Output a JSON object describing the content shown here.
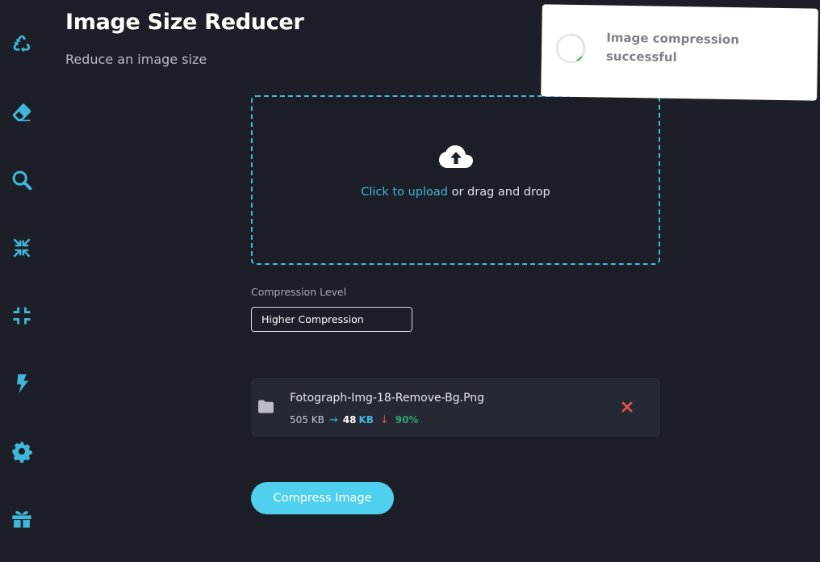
{
  "page": {
    "title": "Image Size Reducer",
    "subtitle": "Reduce an image size"
  },
  "sidebar": {
    "items": [
      {
        "icon": "recycle-icon"
      },
      {
        "icon": "eraser-icon"
      },
      {
        "icon": "search-icon"
      },
      {
        "icon": "compress-arrows-icon"
      },
      {
        "icon": "compress-icon",
        "active": true
      },
      {
        "icon": "bolt-icon"
      },
      {
        "icon": "gear-icon"
      },
      {
        "icon": "gift-icon"
      }
    ]
  },
  "upload": {
    "link_text": "Click to upload",
    "rest_text": " or drag and drop",
    "icon": "cloud-upload-icon"
  },
  "compression": {
    "label": "Compression Level",
    "selected": "Higher Compression"
  },
  "file": {
    "name": "Fotograph-Img-18-Remove-Bg.Png",
    "original_size": "505 KB",
    "new_size": "48",
    "new_unit": "KB",
    "reduction": "90%",
    "icon": "folder-icon"
  },
  "actions": {
    "compress_label": "Compress Image"
  },
  "toast": {
    "message": "Image compression successful"
  },
  "colors": {
    "background": "#1c1f27",
    "accent": "#3fb8d8",
    "button": "#4fd0ee",
    "success": "#2ea66a",
    "danger": "#e35050",
    "card": "#252933"
  }
}
